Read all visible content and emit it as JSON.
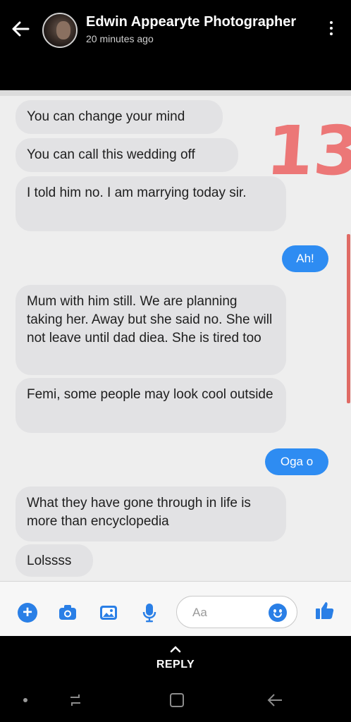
{
  "header": {
    "title": "Edwin Appearyte Photographer",
    "subtitle": "20 minutes ago",
    "back_icon": "arrow-left-icon",
    "menu_icon": "more-vertical-icon"
  },
  "messages": [
    {
      "side": "in",
      "text": "You can change your mind"
    },
    {
      "side": "in",
      "text": "You can call this wedding off"
    },
    {
      "side": "in",
      "text": "I told him no.  I am marrying today sir."
    },
    {
      "side": "out",
      "text": "Ah!"
    },
    {
      "side": "in",
      "text": "Mum with him still.  We are planning taking her. Away but she said no.  She will not leave until dad diea. She is tired too"
    },
    {
      "side": "in",
      "text": "Femi,  some people may look cool outside"
    },
    {
      "side": "out",
      "text": "Oga o"
    },
    {
      "side": "in",
      "text": "What they have gone through in life is more than encyclopedia"
    },
    {
      "side": "in",
      "text": "Lolssss"
    }
  ],
  "stamp": "13",
  "composer": {
    "placeholder": "Aa",
    "icons": [
      "plus-icon",
      "camera-icon",
      "image-icon",
      "microphone-icon",
      "emoji-icon",
      "thumbs-up-icon"
    ]
  },
  "reply": {
    "label": "REPLY"
  },
  "colors": {
    "outgoing_bubble": "#2e8cf2",
    "incoming_bubble": "#e2e2e4",
    "stamp": "#ec6b6b",
    "messenger_blue": "#2a7fe6"
  }
}
